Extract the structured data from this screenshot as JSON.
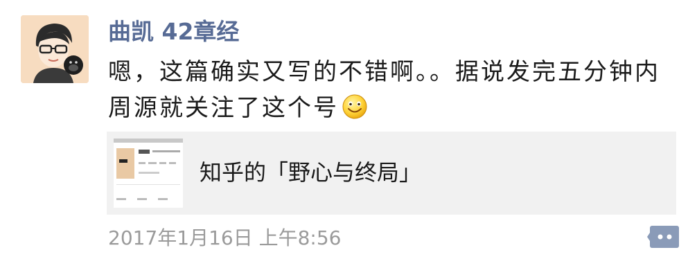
{
  "post": {
    "author": "曲凯 42章经",
    "text": "嗯，这篇确实又写的不错啊。。据说发完五分钟内周源就关注了这个号",
    "emoji_icon": "smiley-emoji-icon",
    "link_card": {
      "title": "知乎的「野心与终局」",
      "thumbnail_icon": "article-thumbnail-icon"
    },
    "timestamp": "2017年1月16日 上午8:56",
    "comment_icon": "comment-dots-icon"
  },
  "colors": {
    "author_name": "#576b95",
    "card_background": "#f1f1f1",
    "timestamp": "#9a9a9a",
    "comment_button": "#8a9bb8"
  }
}
